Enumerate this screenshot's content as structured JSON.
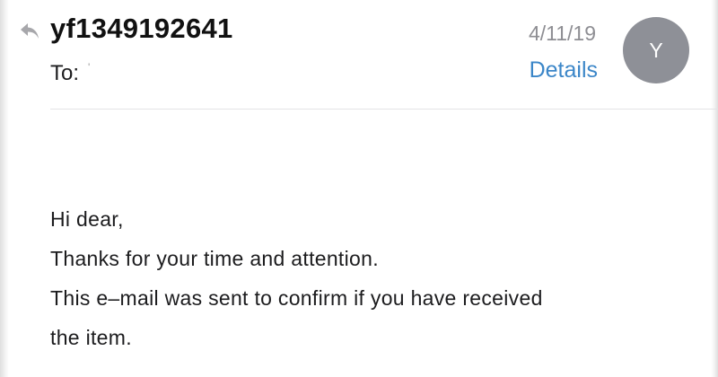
{
  "header": {
    "sender": "yf1349192641",
    "to_label": "To:",
    "to_value": "'",
    "date": "4/11/19",
    "details_label": "Details",
    "avatar_initial": "Y"
  },
  "icons": {
    "reply": "reply-arrow-icon"
  },
  "body": {
    "lines": [
      "Hi dear,",
      "Thanks for your time and attention.",
      "This e–mail was sent to confirm if you have received",
      "the item."
    ]
  },
  "colors": {
    "link": "#3b86c8",
    "avatar_bg": "#8e9097",
    "meta_text": "#8e8e93"
  }
}
